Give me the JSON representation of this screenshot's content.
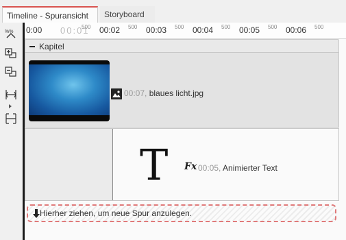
{
  "tabs": [
    {
      "label": "Timeline - Spuransicht",
      "active": true
    },
    {
      "label": "Storyboard",
      "active": false
    }
  ],
  "toolbar": {
    "icons": [
      "zoom-icon",
      "add-track-icon",
      "remove-track-icon",
      "fit-width-icon",
      "fit-all-icon"
    ]
  },
  "ruler": {
    "major": [
      "0:00",
      "00:01",
      "00:02",
      "00:03",
      "00:04",
      "00:05",
      "00:06"
    ],
    "minor": "500"
  },
  "chapter": {
    "label": "Kapitel"
  },
  "clips": [
    {
      "time": "00:07,",
      "name": "blaues licht.jpg",
      "type": "image"
    },
    {
      "time": "00:05,",
      "name": "Animierter Text",
      "type": "text"
    }
  ],
  "text_clip": {
    "glyph": "T",
    "fx": "Fx"
  },
  "drop_zone": {
    "label": "Hierher ziehen, um neue Spur anzulegen."
  },
  "colors": {
    "tab_accent": "#d9534f",
    "drop_border": "#e07a7a",
    "thumb_blue": "#2e8ac8"
  }
}
